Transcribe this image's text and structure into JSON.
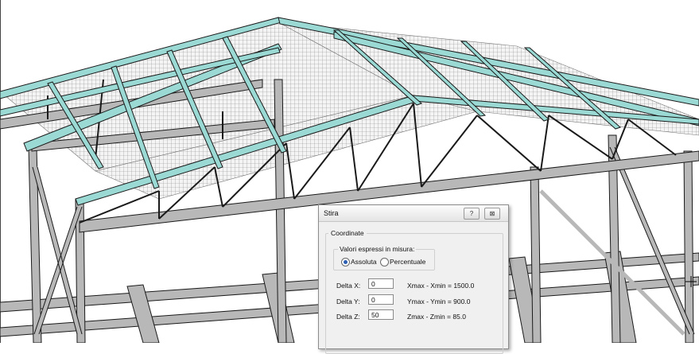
{
  "dialog": {
    "title": "Stira",
    "help_icon": "?",
    "close_icon": "⊠",
    "group_title": "Coordinate",
    "values_group_title": "Valori espressi in misura:",
    "radio_absolute": "Assoluta",
    "radio_percent": "Percentuale",
    "selected": "Assoluta",
    "fields": [
      {
        "label": "Delta X:",
        "value": "0",
        "range": "Xmax - Xmin = 1500.0"
      },
      {
        "label": "Delta Y:",
        "value": "0",
        "range": "Ymax - Ymin = 900.0"
      },
      {
        "label": "Delta Z:",
        "value": "50",
        "range": "Zmax - Zmin = 85.0"
      }
    ]
  },
  "colors": {
    "beam_teal": "#9ad9d4",
    "beam_gray": "#b4b4b4",
    "edge": "#1a1a1a",
    "mesh": "#c8c8c8",
    "dialog_bg": "#f0f0f0"
  }
}
